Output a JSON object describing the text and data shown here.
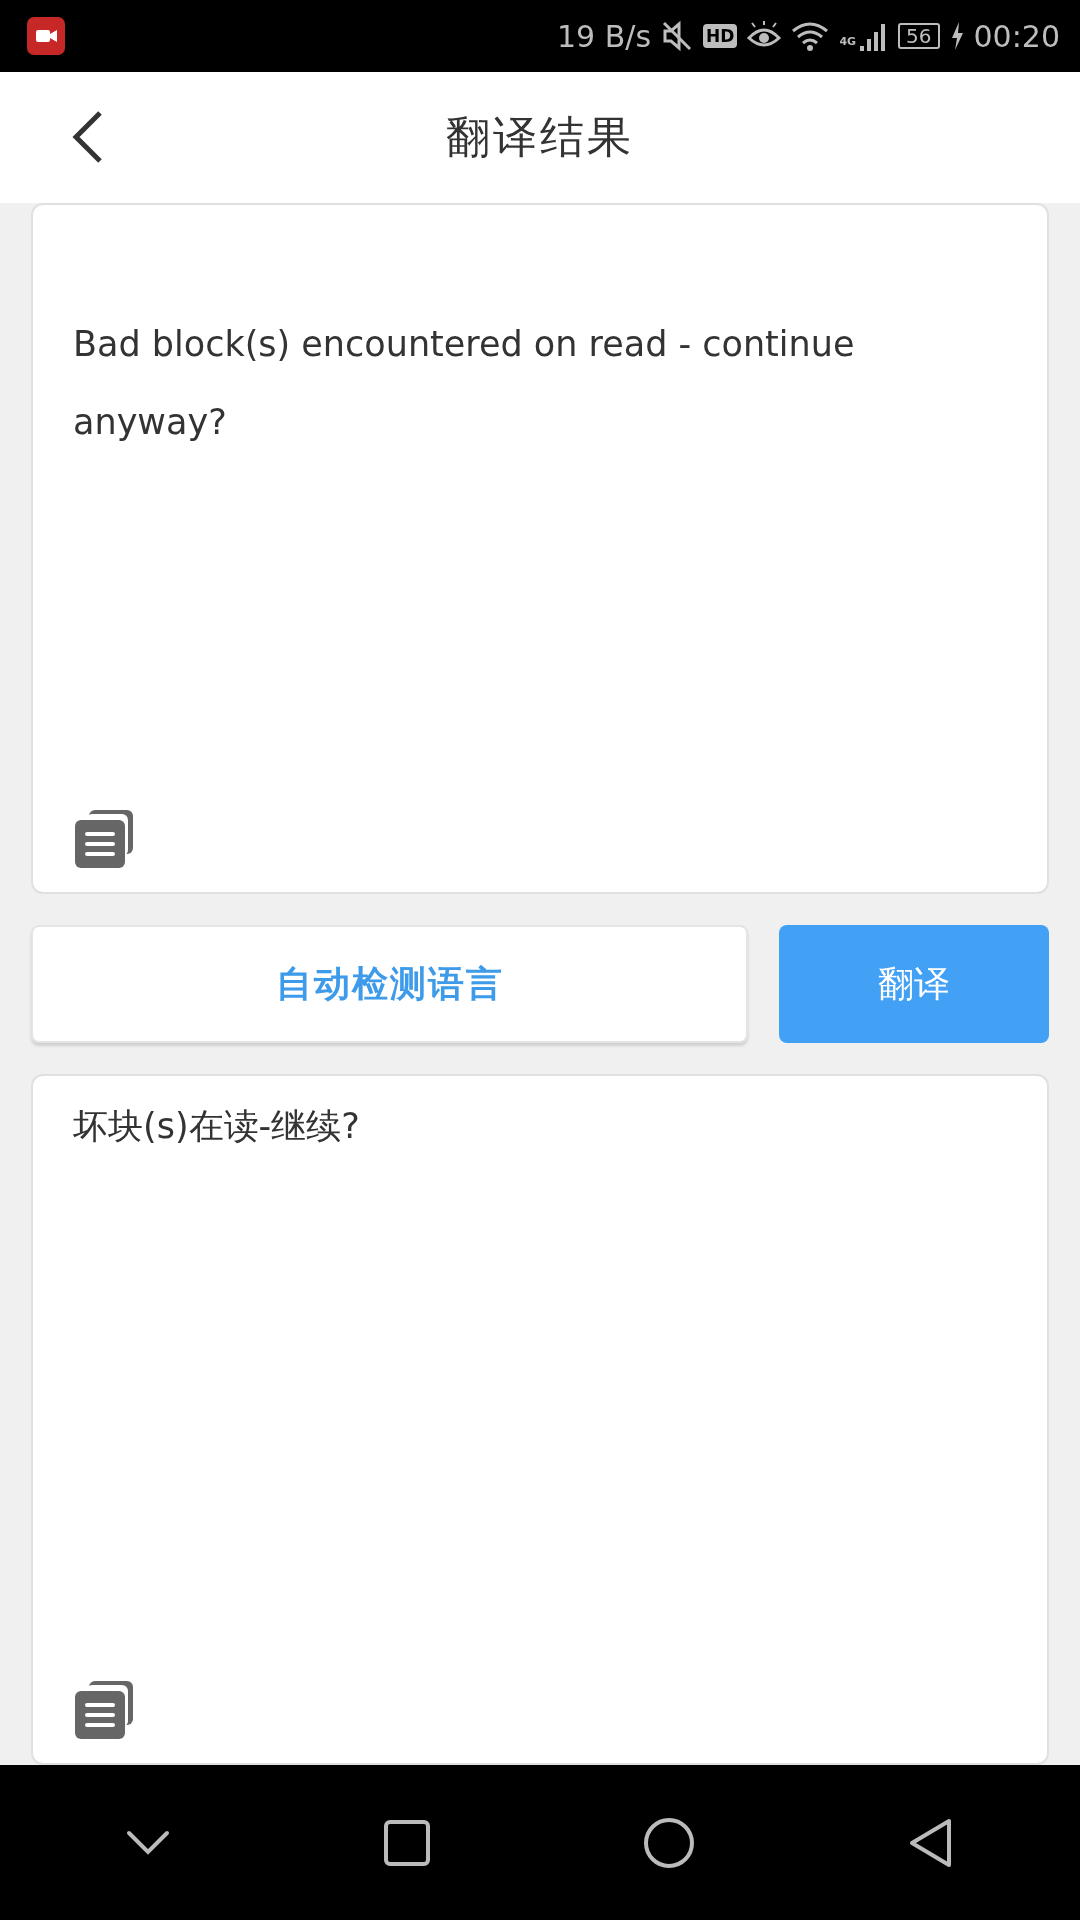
{
  "status_bar": {
    "network_speed": "19 B/s",
    "hd_label": "HD",
    "network_type": "4G",
    "battery": "56",
    "time": "00:20"
  },
  "header": {
    "title": "翻译结果"
  },
  "source_card": {
    "text": "Bad block(s) encountered on read - continue anyway?"
  },
  "actions": {
    "language_button": "自动检测语言",
    "translate_button": "翻译"
  },
  "result_card": {
    "text": "坏块(s)在读-继续?"
  }
}
